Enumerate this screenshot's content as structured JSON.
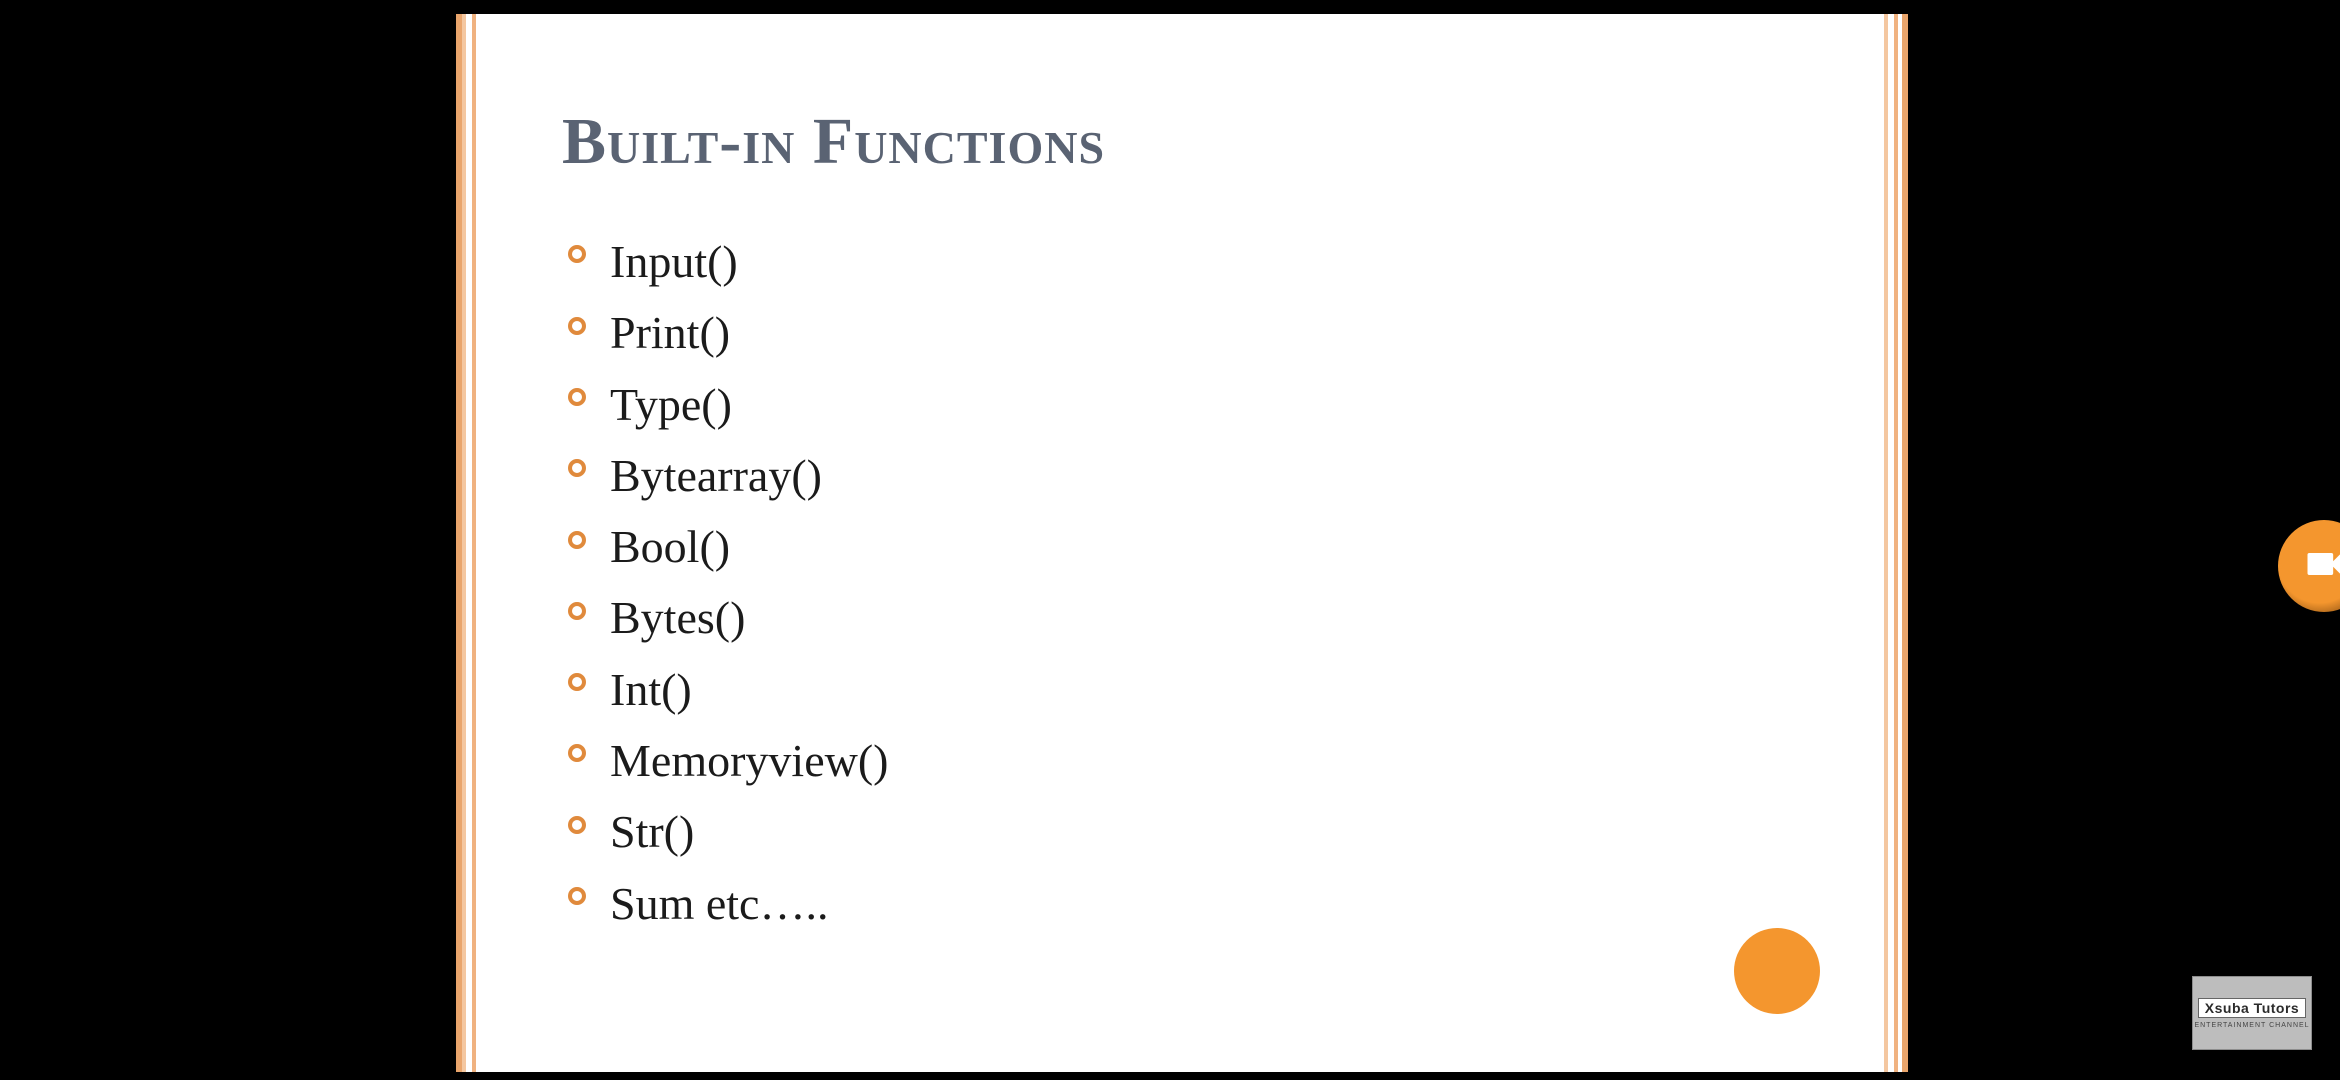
{
  "slide": {
    "title": "Built-in Functions",
    "bullets": [
      "Input()",
      "Print()",
      "Type()",
      "Bytearray()",
      "Bool()",
      "Bytes()",
      "Int()",
      "Memoryview()",
      "Str()",
      "Sum   etc….."
    ]
  },
  "watermark": {
    "main": "Xsuba Tutors",
    "sub": "ENTERTAINMENT CHANNEL"
  },
  "colors": {
    "accent": "#f4962e",
    "title": "#5a6373",
    "rule": "#e9a56c"
  }
}
